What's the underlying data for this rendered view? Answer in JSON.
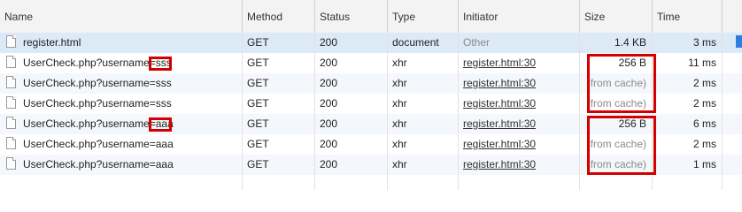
{
  "columns": {
    "name": "Name",
    "method": "Method",
    "status": "Status",
    "type": "Type",
    "initiator": "Initiator",
    "size": "Size",
    "time": "Time"
  },
  "rows": [
    {
      "name": "register.html",
      "method": "GET",
      "status": "200",
      "type": "document",
      "initiator": "Other",
      "size": "1.4 KB",
      "time": "3 ms"
    },
    {
      "name": "UserCheck.php?username=sss",
      "method": "GET",
      "status": "200",
      "type": "xhr",
      "initiator": "register.html:30",
      "size": "256 B",
      "time": "11 ms"
    },
    {
      "name": "UserCheck.php?username=sss",
      "method": "GET",
      "status": "200",
      "type": "xhr",
      "initiator": "register.html:30",
      "size": "(from cache)",
      "time": "2 ms"
    },
    {
      "name": "UserCheck.php?username=sss",
      "method": "GET",
      "status": "200",
      "type": "xhr",
      "initiator": "register.html:30",
      "size": "(from cache)",
      "time": "2 ms"
    },
    {
      "name": "UserCheck.php?username=aaa",
      "method": "GET",
      "status": "200",
      "type": "xhr",
      "initiator": "register.html:30",
      "size": "256 B",
      "time": "6 ms"
    },
    {
      "name": "UserCheck.php?username=aaa",
      "method": "GET",
      "status": "200",
      "type": "xhr",
      "initiator": "register.html:30",
      "size": "(from cache)",
      "time": "2 ms"
    },
    {
      "name": "UserCheck.php?username=aaa",
      "method": "GET",
      "status": "200",
      "type": "xhr",
      "initiator": "register.html:30",
      "size": "(from cache)",
      "time": "1 ms"
    }
  ],
  "colors": {
    "annotation": "#d40000",
    "selected_row": "#dce9f7",
    "waterfall_bar": "#2f7de1"
  }
}
